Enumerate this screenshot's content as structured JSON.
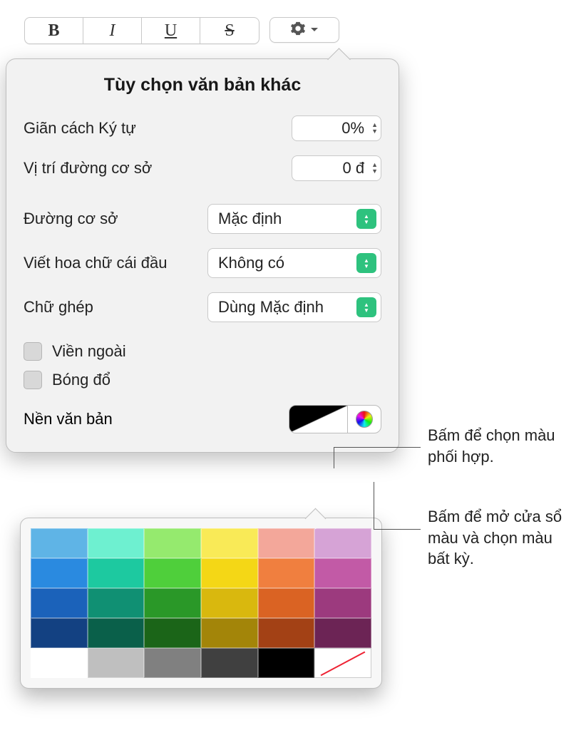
{
  "toolbar": {
    "bold": "B",
    "italic": "I",
    "underline": "U",
    "strike": "S"
  },
  "popover": {
    "title": "Tùy chọn văn bản khác",
    "char_spacing_label": "Giãn cách Ký tự",
    "char_spacing_value": "0%",
    "baseline_pos_label": "Vị trí đường cơ sở",
    "baseline_pos_value": "0 đ",
    "baseline_label": "Đường cơ sở",
    "baseline_value": "Mặc định",
    "caps_label": "Viết hoa chữ cái đầu",
    "caps_value": "Không có",
    "ligature_label": "Chữ ghép",
    "ligature_value": "Dùng Mặc định",
    "outline_label": "Viền ngoài",
    "shadow_label": "Bóng đổ",
    "text_bg_label": "Nền văn bản"
  },
  "callouts": {
    "swatch": "Bấm để chọn màu phối hợp.",
    "wheel": "Bấm để mở cửa sổ màu và chọn màu bất kỳ."
  },
  "palette_colors": [
    [
      "#5fb4e6",
      "#6ef0d0",
      "#95ea6e",
      "#f9ea57",
      "#f3a79a",
      "#d6a3d6"
    ],
    [
      "#2a8ae0",
      "#1dc9a0",
      "#4fcf3b",
      "#f4d716",
      "#f07f3f",
      "#c25aa6"
    ],
    [
      "#1b62ba",
      "#109073",
      "#2a9828",
      "#d9b80e",
      "#da6323",
      "#9c3a7e"
    ],
    [
      "#134182",
      "#0a604a",
      "#1b6518",
      "#a38509",
      "#a34115",
      "#6c2455"
    ],
    [
      "#ffffff",
      "#bfbfbf",
      "#808080",
      "#404040",
      "#000000",
      "none"
    ]
  ]
}
